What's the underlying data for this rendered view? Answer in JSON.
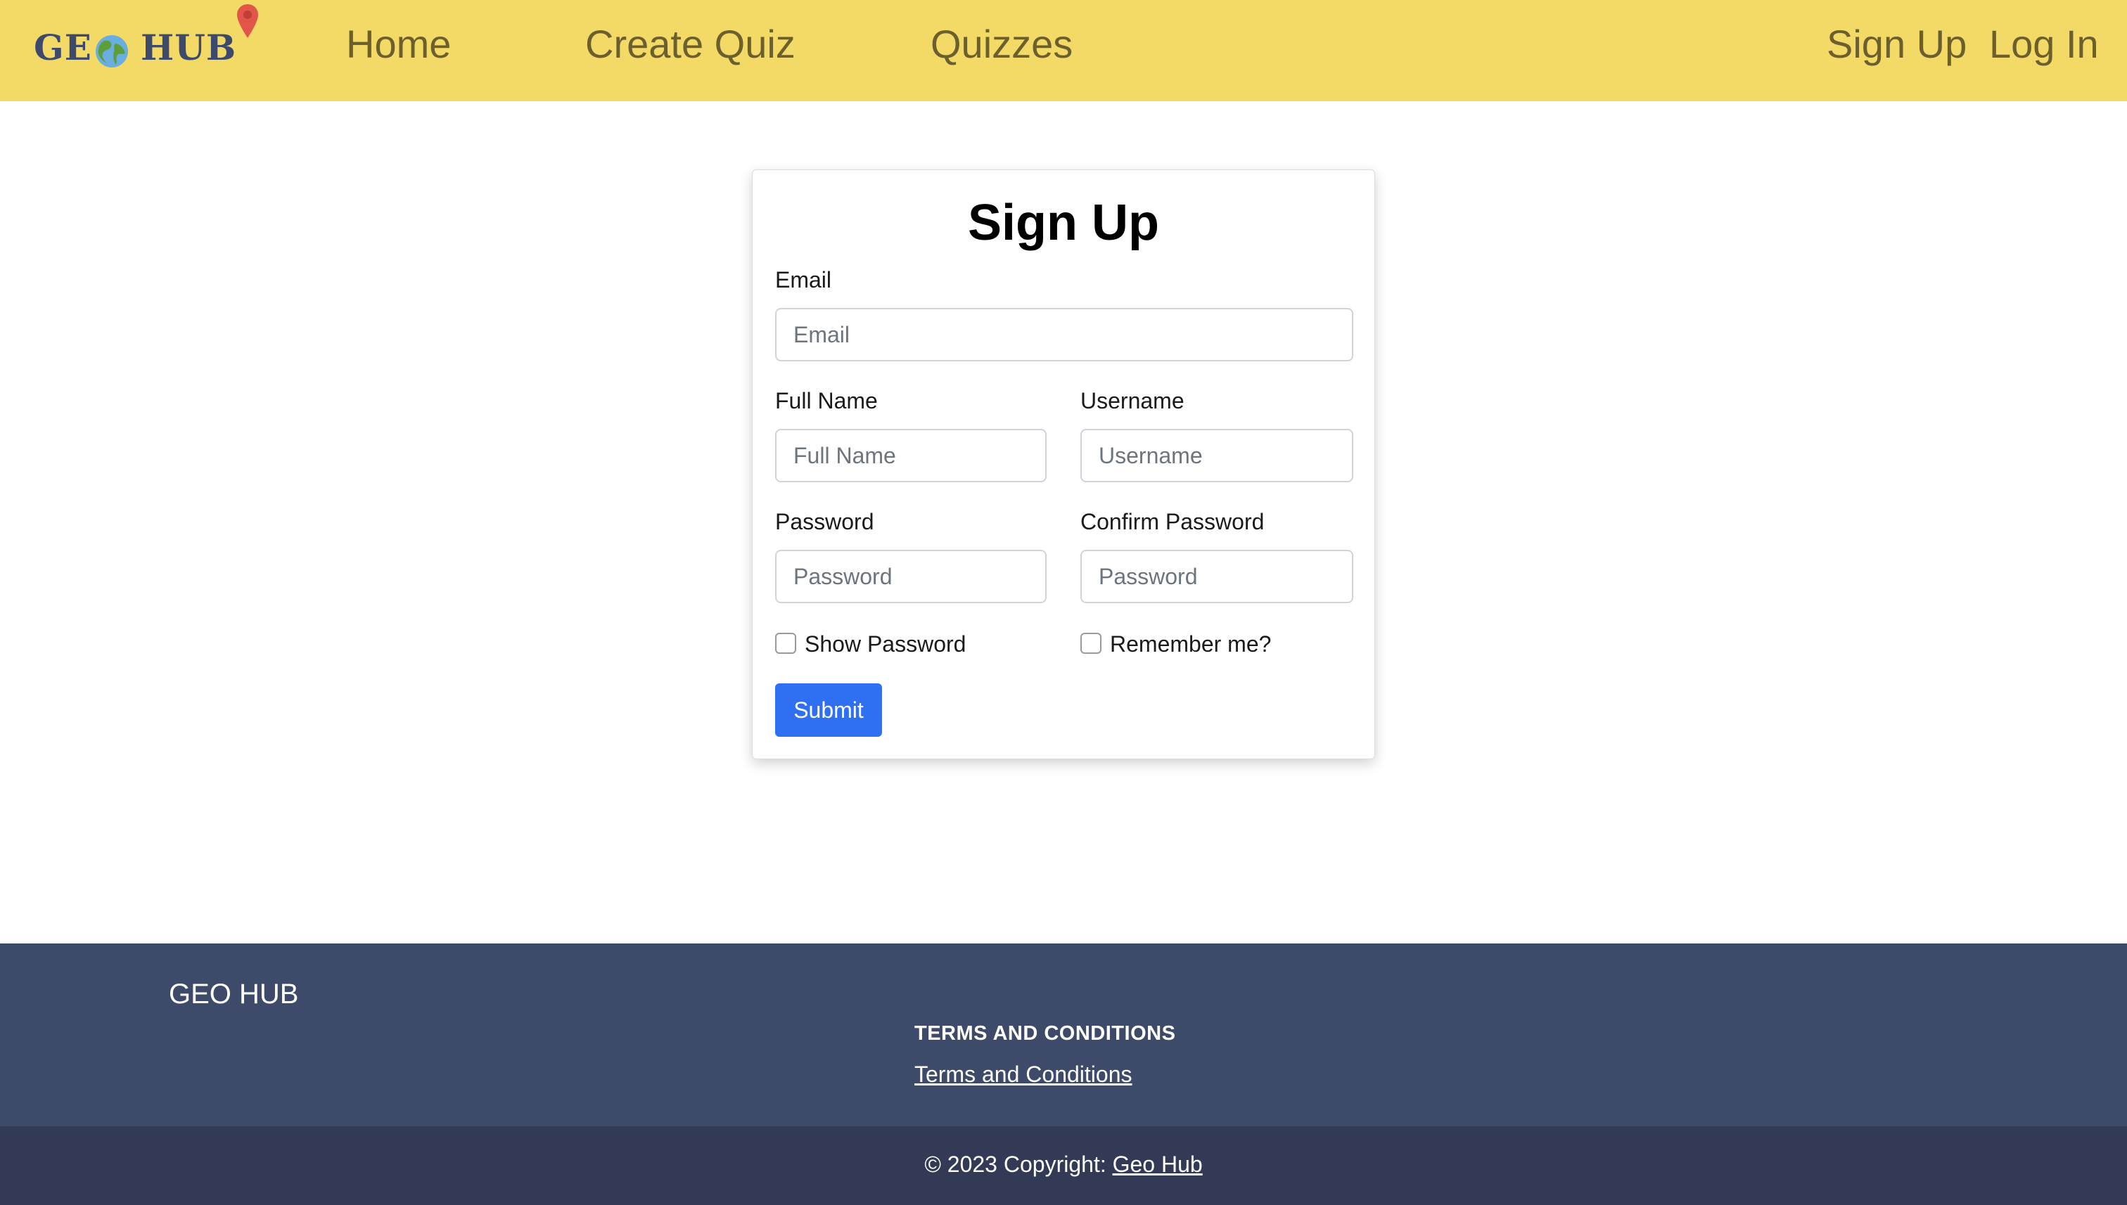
{
  "navbar": {
    "logo": {
      "part1": "GE",
      "part2": "HUB",
      "alt": "GEO HUB"
    },
    "links": {
      "home": "Home",
      "create_quiz": "Create Quiz",
      "quizzes": "Quizzes",
      "sign_up": "Sign Up",
      "log_in": "Log In"
    },
    "colors": {
      "background": "#f3d965",
      "link": "#6b5f2e"
    }
  },
  "form": {
    "title": "Sign Up",
    "email": {
      "label": "Email",
      "placeholder": "Email",
      "value": ""
    },
    "full_name": {
      "label": "Full Name",
      "placeholder": "Full Name",
      "value": ""
    },
    "username": {
      "label": "Username",
      "placeholder": "Username",
      "value": ""
    },
    "password": {
      "label": "Password",
      "placeholder": "Password",
      "value": ""
    },
    "confirm_password": {
      "label": "Confirm Password",
      "placeholder": "Password",
      "value": ""
    },
    "show_password": {
      "label": "Show Password",
      "checked": false
    },
    "remember_me": {
      "label": "Remember me?",
      "checked": false
    },
    "submit_label": "Submit",
    "colors": {
      "submit": "#2f6ff2"
    }
  },
  "footer": {
    "brand": "GEO HUB",
    "section_heading": "TERMS AND CONDITIONS",
    "terms_link": "Terms and Conditions",
    "copyright_prefix": "© 2023 Copyright: ",
    "copyright_link": "Geo Hub",
    "colors": {
      "background": "#3e4a6a",
      "bottom_bar": "#333a55"
    }
  },
  "icons": {
    "globe": "globe-icon",
    "pin": "map-pin-icon"
  }
}
